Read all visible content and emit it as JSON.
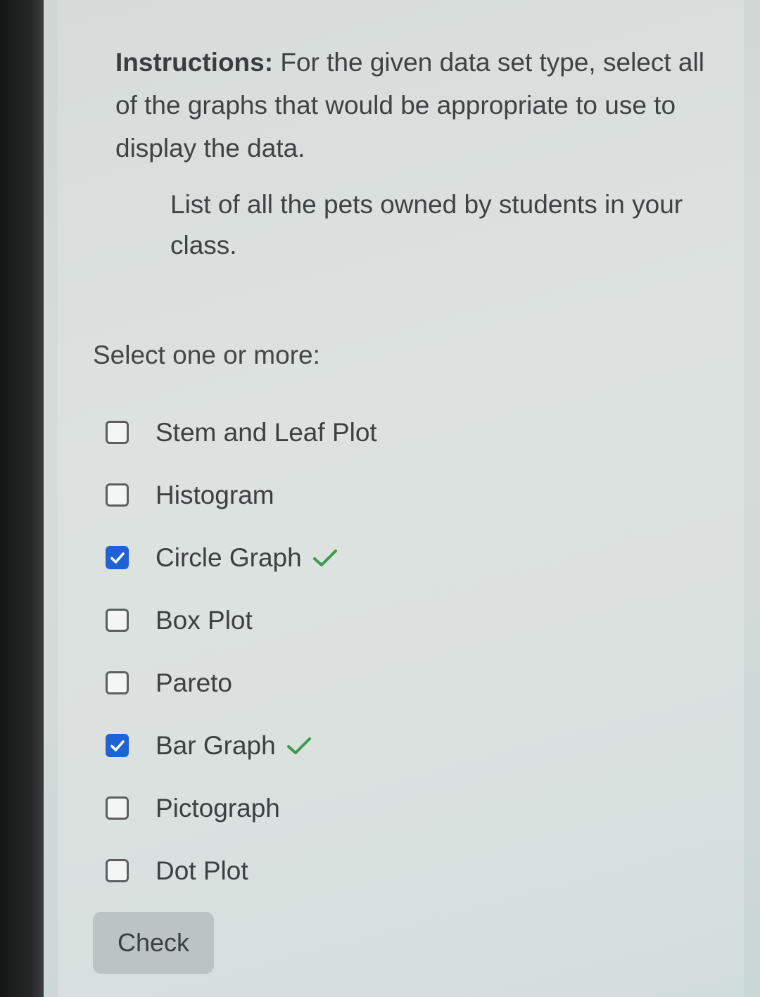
{
  "question": {
    "instructions_label": "Instructions:",
    "instructions_text": " For the given data set type, select all of the graphs that would be appropriate to use to display the data.",
    "dataset": "List of all the pets owned by students in your class.",
    "prompt": "Select one or more:"
  },
  "options": [
    {
      "label": "Stem and Leaf Plot",
      "checked": false,
      "correct": false
    },
    {
      "label": "Histogram",
      "checked": false,
      "correct": false
    },
    {
      "label": "Circle Graph",
      "checked": true,
      "correct": true
    },
    {
      "label": "Box Plot",
      "checked": false,
      "correct": false
    },
    {
      "label": "Pareto",
      "checked": false,
      "correct": false
    },
    {
      "label": "Bar Graph",
      "checked": true,
      "correct": true
    },
    {
      "label": "Pictograph",
      "checked": false,
      "correct": false
    },
    {
      "label": "Dot Plot",
      "checked": false,
      "correct": false
    }
  ],
  "check_button": {
    "label": "Check"
  },
  "colors": {
    "checked_box": "#1f62d6",
    "correct_mark": "#3d9a4a",
    "text": "#3d4041"
  },
  "icons": {
    "checkbox_checked": "checkmark-icon",
    "correct": "green-checkmark-icon"
  }
}
